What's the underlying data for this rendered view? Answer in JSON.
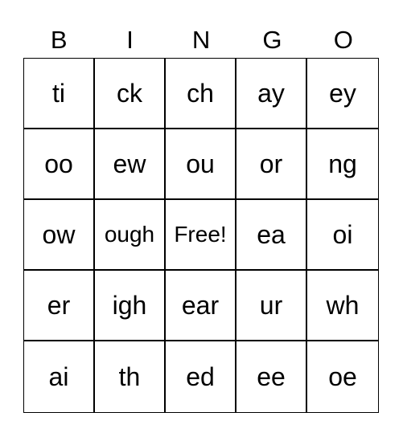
{
  "header": [
    "B",
    "I",
    "N",
    "G",
    "O"
  ],
  "rows": [
    [
      "ti",
      "ck",
      "ch",
      "ay",
      "ey"
    ],
    [
      "oo",
      "ew",
      "ou",
      "or",
      "ng"
    ],
    [
      "ow",
      "ough",
      "Free!",
      "ea",
      "oi"
    ],
    [
      "er",
      "igh",
      "ear",
      "ur",
      "wh"
    ],
    [
      "ai",
      "th",
      "ed",
      "ee",
      "oe"
    ]
  ]
}
